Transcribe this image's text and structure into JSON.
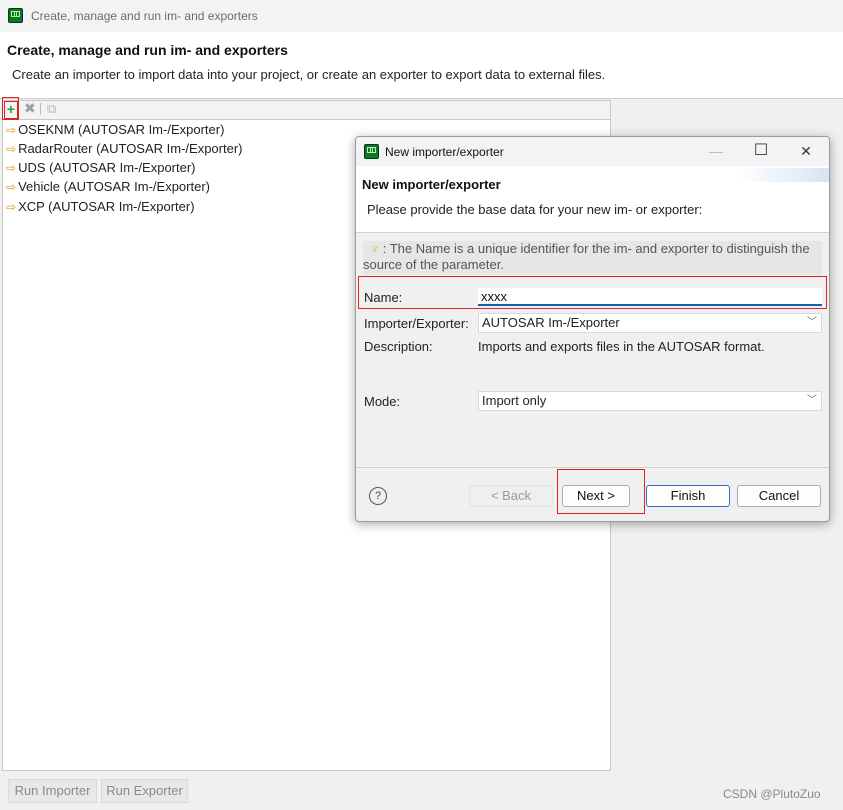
{
  "window": {
    "title": "Create, manage and run im- and exporters"
  },
  "page": {
    "title": "Create, manage and run im- and exporters",
    "description": "Create an importer to import data into your project, or create an exporter to export data to external files."
  },
  "toolbar": {
    "add": "+",
    "delete": "✖",
    "copy": "⧉"
  },
  "list": {
    "items": [
      "OSEKNM (AUTOSAR Im-/Exporter)",
      "RadarRouter (AUTOSAR Im-/Exporter)",
      "UDS (AUTOSAR Im-/Exporter)",
      "Vehicle (AUTOSAR Im-/Exporter)",
      "XCP (AUTOSAR Im-/Exporter)"
    ]
  },
  "bottom": {
    "run_importer": "Run Importer",
    "run_exporter": "Run Exporter"
  },
  "watermark": "CSDN @PlutoZuo",
  "dialog": {
    "title": "New importer/exporter",
    "minimize": "—",
    "maximize": "☐",
    "close": "✕",
    "header_title": "New importer/exporter",
    "header_desc": "Please provide the base data for your new im- or exporter:",
    "info": ": The Name is a unique identifier for the im- and exporter to distinguish the source of the parameter.",
    "name_label": "Name:",
    "name_value": "xxxx",
    "type_label": "Importer/Exporter:",
    "type_value": "AUTOSAR Im-/Exporter",
    "desc_label": "Description:",
    "desc_value": "Imports and exports files in the AUTOSAR format.",
    "mode_label": "Mode:",
    "mode_value": "Import only",
    "help": "?",
    "back": "< Back",
    "next": "Next >",
    "finish": "Finish",
    "cancel": "Cancel"
  }
}
